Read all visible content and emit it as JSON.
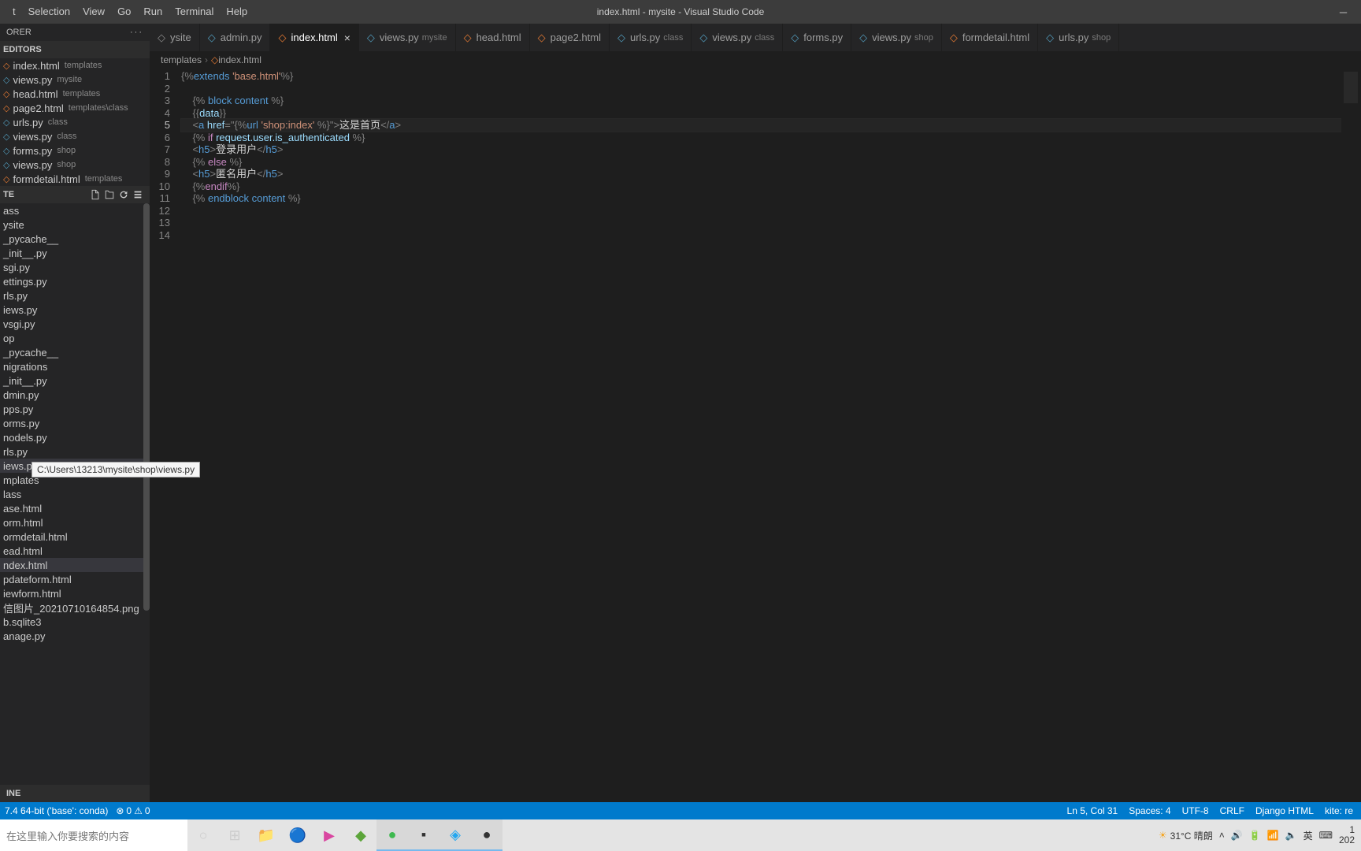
{
  "window_title": "index.html - mysite - Visual Studio Code",
  "menu": [
    "t",
    "Selection",
    "View",
    "Go",
    "Run",
    "Terminal",
    "Help"
  ],
  "sidebar": {
    "header": "ORER",
    "open_editors_label": "EDITORS",
    "open_editors": [
      {
        "name": "index.html",
        "desc": "templates",
        "icon": "html"
      },
      {
        "name": "views.py",
        "desc": "mysite",
        "icon": "py"
      },
      {
        "name": "head.html",
        "desc": "templates",
        "icon": "html"
      },
      {
        "name": "page2.html",
        "desc": "templates\\class",
        "icon": "html"
      },
      {
        "name": "urls.py",
        "desc": "class",
        "icon": "py"
      },
      {
        "name": "views.py",
        "desc": "class",
        "icon": "py"
      },
      {
        "name": "forms.py",
        "desc": "shop",
        "icon": "py"
      },
      {
        "name": "views.py",
        "desc": "shop",
        "icon": "py"
      },
      {
        "name": "formdetail.html",
        "desc": "templates",
        "icon": "html"
      }
    ],
    "workspace_label": "TE",
    "files": [
      {
        "name": "ass",
        "type": "folder"
      },
      {
        "name": "ysite",
        "type": "folder"
      },
      {
        "name": "_pycache__",
        "type": "folder"
      },
      {
        "name": "_init__.py",
        "type": "py"
      },
      {
        "name": "sgi.py",
        "type": "py"
      },
      {
        "name": "ettings.py",
        "type": "py"
      },
      {
        "name": "rls.py",
        "type": "py"
      },
      {
        "name": "iews.py",
        "type": "py"
      },
      {
        "name": "vsgi.py",
        "type": "py"
      },
      {
        "name": "op",
        "type": "folder"
      },
      {
        "name": "_pycache__",
        "type": "folder"
      },
      {
        "name": "nigrations",
        "type": "folder"
      },
      {
        "name": "_init__.py",
        "type": "py"
      },
      {
        "name": "dmin.py",
        "type": "py"
      },
      {
        "name": "pps.py",
        "type": "py"
      },
      {
        "name": "orms.py",
        "type": "py"
      },
      {
        "name": "nodels.py",
        "type": "py"
      },
      {
        "name": "rls.py",
        "type": "py"
      },
      {
        "name": "iews.py",
        "type": "py",
        "hover": true
      },
      {
        "name": "mplates",
        "type": "folder"
      },
      {
        "name": "lass",
        "type": "folder"
      },
      {
        "name": "ase.html",
        "type": "html"
      },
      {
        "name": "orm.html",
        "type": "html"
      },
      {
        "name": "ormdetail.html",
        "type": "html"
      },
      {
        "name": "ead.html",
        "type": "html"
      },
      {
        "name": "ndex.html",
        "type": "html",
        "selected": true
      },
      {
        "name": "pdateform.html",
        "type": "html"
      },
      {
        "name": "iewform.html",
        "type": "html"
      },
      {
        "name": "信图片_20210710164854.png",
        "type": "img"
      },
      {
        "name": "b.sqlite3",
        "type": "db"
      },
      {
        "name": "anage.py",
        "type": "py"
      }
    ],
    "outline_label": "INE"
  },
  "tooltip": "C:\\Users\\13213\\mysite\\shop\\views.py",
  "tabs": [
    {
      "name": "ysite",
      "icon": "",
      "desc": ""
    },
    {
      "name": "admin.py",
      "icon": "py",
      "desc": ""
    },
    {
      "name": "index.html",
      "icon": "html",
      "desc": "",
      "active": true,
      "close": true
    },
    {
      "name": "views.py",
      "icon": "py",
      "desc": "mysite"
    },
    {
      "name": "head.html",
      "icon": "html",
      "desc": ""
    },
    {
      "name": "page2.html",
      "icon": "html",
      "desc": ""
    },
    {
      "name": "urls.py",
      "icon": "py",
      "desc": "class"
    },
    {
      "name": "views.py",
      "icon": "py",
      "desc": "class"
    },
    {
      "name": "forms.py",
      "icon": "py",
      "desc": ""
    },
    {
      "name": "views.py",
      "icon": "py",
      "desc": "shop"
    },
    {
      "name": "formdetail.html",
      "icon": "html",
      "desc": ""
    },
    {
      "name": "urls.py",
      "icon": "py",
      "desc": "shop"
    }
  ],
  "breadcrumb": [
    "templates",
    "index.html"
  ],
  "code_lines": [
    {
      "n": 1,
      "segs": [
        [
          "{%",
          "tag"
        ],
        [
          "extends ",
          "tmpl"
        ],
        [
          "'base.html'",
          "str"
        ],
        [
          "%}",
          "tag"
        ]
      ]
    },
    {
      "n": 2,
      "segs": []
    },
    {
      "n": 3,
      "segs": [
        [
          "    ",
          ""
        ],
        [
          "{% ",
          "tag"
        ],
        [
          "block content ",
          "tmpl"
        ],
        [
          "%}",
          "tag"
        ]
      ]
    },
    {
      "n": 4,
      "segs": [
        [
          "    ",
          ""
        ],
        [
          "{{",
          "tag"
        ],
        [
          "data",
          "var"
        ],
        [
          "}}",
          "tag"
        ]
      ]
    },
    {
      "n": 5,
      "cur": true,
      "segs": [
        [
          "    ",
          ""
        ],
        [
          "<",
          "tag"
        ],
        [
          "a ",
          "elem"
        ],
        [
          "href",
          "attr"
        ],
        [
          "=",
          "tag"
        ],
        [
          "\"{%",
          "tag"
        ],
        [
          "url ",
          "tmpl"
        ],
        [
          "'shop:index'",
          "str"
        ],
        [
          " %}\"",
          "tag"
        ],
        [
          ">",
          "tag"
        ],
        [
          "这是首页",
          ""
        ],
        [
          "</",
          "tag"
        ],
        [
          "a",
          "elem"
        ],
        [
          ">",
          "tag"
        ]
      ]
    },
    {
      "n": 6,
      "segs": [
        [
          "    ",
          ""
        ],
        [
          "{% ",
          "tag"
        ],
        [
          "if ",
          "kw"
        ],
        [
          "request.user.is_authenticated ",
          "var"
        ],
        [
          "%}",
          "tag"
        ]
      ]
    },
    {
      "n": 7,
      "segs": [
        [
          "    ",
          ""
        ],
        [
          "<",
          "tag"
        ],
        [
          "h5",
          "elem"
        ],
        [
          ">",
          "tag"
        ],
        [
          "登录用户",
          ""
        ],
        [
          "</",
          "tag"
        ],
        [
          "h5",
          "elem"
        ],
        [
          ">",
          "tag"
        ]
      ]
    },
    {
      "n": 8,
      "segs": [
        [
          "    ",
          ""
        ],
        [
          "{% ",
          "tag"
        ],
        [
          "else ",
          "kw"
        ],
        [
          "%}",
          "tag"
        ]
      ]
    },
    {
      "n": 9,
      "segs": [
        [
          "    ",
          ""
        ],
        [
          "<",
          "tag"
        ],
        [
          "h5",
          "elem"
        ],
        [
          ">",
          "tag"
        ],
        [
          "匿名用户",
          ""
        ],
        [
          "</",
          "tag"
        ],
        [
          "h5",
          "elem"
        ],
        [
          ">",
          "tag"
        ]
      ]
    },
    {
      "n": 10,
      "segs": [
        [
          "    ",
          ""
        ],
        [
          "{%",
          "tag"
        ],
        [
          "endif",
          "kw"
        ],
        [
          "%}",
          "tag"
        ]
      ]
    },
    {
      "n": 11,
      "segs": [
        [
          "    ",
          ""
        ],
        [
          "{% ",
          "tag"
        ],
        [
          "endblock content ",
          "tmpl"
        ],
        [
          "%}",
          "tag"
        ]
      ]
    },
    {
      "n": 12,
      "segs": []
    },
    {
      "n": 13,
      "segs": []
    },
    {
      "n": 14,
      "segs": []
    }
  ],
  "status": {
    "python": "7.4 64-bit ('base': conda)",
    "errors": "0",
    "warnings": "0",
    "line_col": "Ln 5, Col 31",
    "spaces": "Spaces: 4",
    "encoding": "UTF-8",
    "eol": "CRLF",
    "lang": "Django HTML",
    "kite": "kite: re"
  },
  "taskbar": {
    "search_placeholder": "在这里输入你要搜索的内容",
    "weather": "31°C  晴朗",
    "time1": "1",
    "time2": "202"
  }
}
